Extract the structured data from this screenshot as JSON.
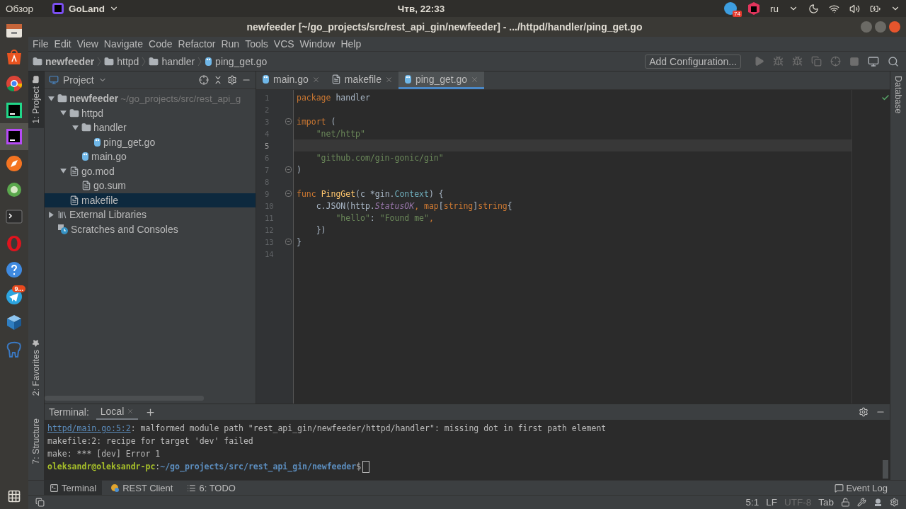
{
  "top_bar": {
    "overview": "Обзор",
    "app": "GoLand",
    "clock": "Чтв, 22:33",
    "tray_badge": "74",
    "language": "ru"
  },
  "dock": {
    "items": [
      {
        "kind": "files",
        "selected": false
      },
      {
        "kind": "store",
        "selected": false
      },
      {
        "kind": "browser",
        "selected": false
      },
      {
        "kind": "pycharm",
        "selected": false
      },
      {
        "kind": "goland",
        "selected": true
      },
      {
        "kind": "compass",
        "selected": false
      },
      {
        "kind": "globe",
        "selected": false
      },
      {
        "kind": "terminal",
        "selected": false
      },
      {
        "kind": "opera",
        "selected": false
      },
      {
        "kind": "help",
        "selected": false
      },
      {
        "kind": "telegram",
        "selected": false,
        "badge": "9..."
      },
      {
        "kind": "app",
        "selected": false
      },
      {
        "kind": "elephant",
        "selected": false
      }
    ]
  },
  "window": {
    "title": "newfeeder [~/go_projects/src/rest_api_gin/newfeeder] - .../httpd/handler/ping_get.go"
  },
  "menu": [
    "File",
    "Edit",
    "View",
    "Navigate",
    "Code",
    "Refactor",
    "Run",
    "Tools",
    "VCS",
    "Window",
    "Help"
  ],
  "breadcrumbs": [
    {
      "label": "newfeeder",
      "kind": "folder"
    },
    {
      "label": "httpd",
      "kind": "folder"
    },
    {
      "label": "handler",
      "kind": "folder"
    },
    {
      "label": "ping_get.go",
      "kind": "gofile"
    }
  ],
  "add_configuration": "Add Configuration...",
  "left_tools": [
    {
      "label": "1: Project",
      "selected": true
    },
    {
      "label": "2: Favorites",
      "selected": false
    }
  ],
  "structure_tool": "7: Structure",
  "project_panel": {
    "title": "Project",
    "tree": [
      {
        "label": "newfeeder",
        "hint": "~/go_projects/src/rest_api_g",
        "kind": "folder",
        "expanded": true,
        "selected": false,
        "children": [
          {
            "label": "httpd",
            "kind": "folder",
            "expanded": true,
            "selected": false,
            "children": [
              {
                "label": "handler",
                "kind": "folder",
                "expanded": true,
                "selected": false,
                "children": [
                  {
                    "label": "ping_get.go",
                    "kind": "gofile",
                    "selected": false
                  }
                ]
              },
              {
                "label": "main.go",
                "kind": "gofile",
                "selected": false
              }
            ]
          },
          {
            "label": "go.mod",
            "kind": "file",
            "expanded": true,
            "selected": false,
            "children": [
              {
                "label": "go.sum",
                "kind": "file",
                "selected": false
              }
            ]
          },
          {
            "label": "makefile",
            "kind": "file",
            "selected": true
          }
        ]
      },
      {
        "label": "External Libraries",
        "kind": "libraries",
        "expanded": false,
        "selected": false
      },
      {
        "label": "Scratches and Consoles",
        "kind": "scratches",
        "selected": false
      }
    ]
  },
  "editor": {
    "tabs": [
      {
        "label": "main.go",
        "kind": "gofile",
        "selected": false
      },
      {
        "label": "makefile",
        "kind": "file",
        "selected": false
      },
      {
        "label": "ping_get.go",
        "kind": "gofile",
        "selected": true
      }
    ],
    "lines": [
      {
        "number": "1",
        "current": false,
        "fold": false,
        "tokens": [
          {
            "kind": "keyword",
            "text": "package "
          },
          {
            "kind": "plain",
            "text": "handler"
          }
        ]
      },
      {
        "number": "2",
        "current": false,
        "fold": false
      },
      {
        "number": "3",
        "current": false,
        "fold": true,
        "tokens": [
          {
            "kind": "keyword",
            "text": "import "
          },
          {
            "kind": "plain",
            "text": "("
          }
        ]
      },
      {
        "number": "4",
        "current": false,
        "fold": false,
        "tokens": [
          {
            "kind": "string",
            "text": "    \"net/http\""
          }
        ]
      },
      {
        "number": "5",
        "current": true,
        "fold": false
      },
      {
        "number": "6",
        "current": false,
        "fold": false,
        "tokens": [
          {
            "kind": "string",
            "text": "    \"github.com/gin-gonic/gin\""
          }
        ]
      },
      {
        "number": "7",
        "current": false,
        "fold": true,
        "tokens": [
          {
            "kind": "plain",
            "text": ")"
          }
        ]
      },
      {
        "number": "8",
        "current": false,
        "fold": false
      },
      {
        "number": "9",
        "current": false,
        "fold": true,
        "tokens": [
          {
            "kind": "keyword",
            "text": "func "
          },
          {
            "kind": "func",
            "text": "PingGet"
          },
          {
            "kind": "plain",
            "text": "(c *gin."
          },
          {
            "kind": "type",
            "text": "Context"
          },
          {
            "kind": "plain",
            "text": ") {"
          }
        ]
      },
      {
        "number": "10",
        "current": false,
        "fold": false,
        "tokens": [
          {
            "kind": "plain",
            "text": "    c.JSON(http."
          },
          {
            "kind": "constant",
            "text": "StatusOK"
          },
          {
            "kind": "keyword",
            "text": ", map"
          },
          {
            "kind": "plain",
            "text": "["
          },
          {
            "kind": "keyword",
            "text": "string"
          },
          {
            "kind": "plain",
            "text": "]"
          },
          {
            "kind": "keyword",
            "text": "string"
          },
          {
            "kind": "plain",
            "text": "{"
          }
        ]
      },
      {
        "number": "11",
        "current": false,
        "fold": false,
        "tokens": [
          {
            "kind": "string",
            "text": "        \"hello\""
          },
          {
            "kind": "plain",
            "text": ": "
          },
          {
            "kind": "string",
            "text": "\"Found me\""
          },
          {
            "kind": "keyword",
            "text": ","
          }
        ]
      },
      {
        "number": "12",
        "current": false,
        "fold": false,
        "tokens": [
          {
            "kind": "plain",
            "text": "    })"
          }
        ]
      },
      {
        "number": "13",
        "current": false,
        "fold": true,
        "tokens": [
          {
            "kind": "plain",
            "text": "}"
          }
        ]
      },
      {
        "number": "14",
        "current": false,
        "fold": false
      }
    ]
  },
  "right_tools": [
    "Database"
  ],
  "terminal": {
    "title": "Terminal:",
    "tabs": [
      {
        "label": "Local",
        "selected": true
      }
    ],
    "lines": [
      {
        "kind": "error",
        "link": "httpd/main.go:5:2",
        "text": ": malformed module path \"rest_api_gin/newfeeder/httpd/handler\": missing dot in first path element"
      },
      {
        "kind": "plain",
        "text": "makefile:2: recipe for target 'dev' failed"
      },
      {
        "kind": "plain",
        "text": "make: *** [dev] Error 1"
      },
      {
        "kind": "prompt",
        "user": "oleksandr@oleksandr-pc",
        "separator": ":",
        "path": "~/go_projects/src/rest_api_gin/newfeeder",
        "symbol": "$"
      }
    ]
  },
  "bottom_tools": [
    {
      "label": "Terminal",
      "kind": "terminal",
      "selected": true
    },
    {
      "label": "REST Client",
      "kind": "rest",
      "selected": false
    },
    {
      "label": "6: TODO",
      "kind": "todo",
      "selected": false
    }
  ],
  "event_log": "Event Log",
  "status_bar": [
    {
      "text": "5:1",
      "disabled": false
    },
    {
      "text": "LF",
      "disabled": false
    },
    {
      "text": "UTF-8",
      "disabled": true
    },
    {
      "text": "Tab",
      "disabled": false
    }
  ]
}
